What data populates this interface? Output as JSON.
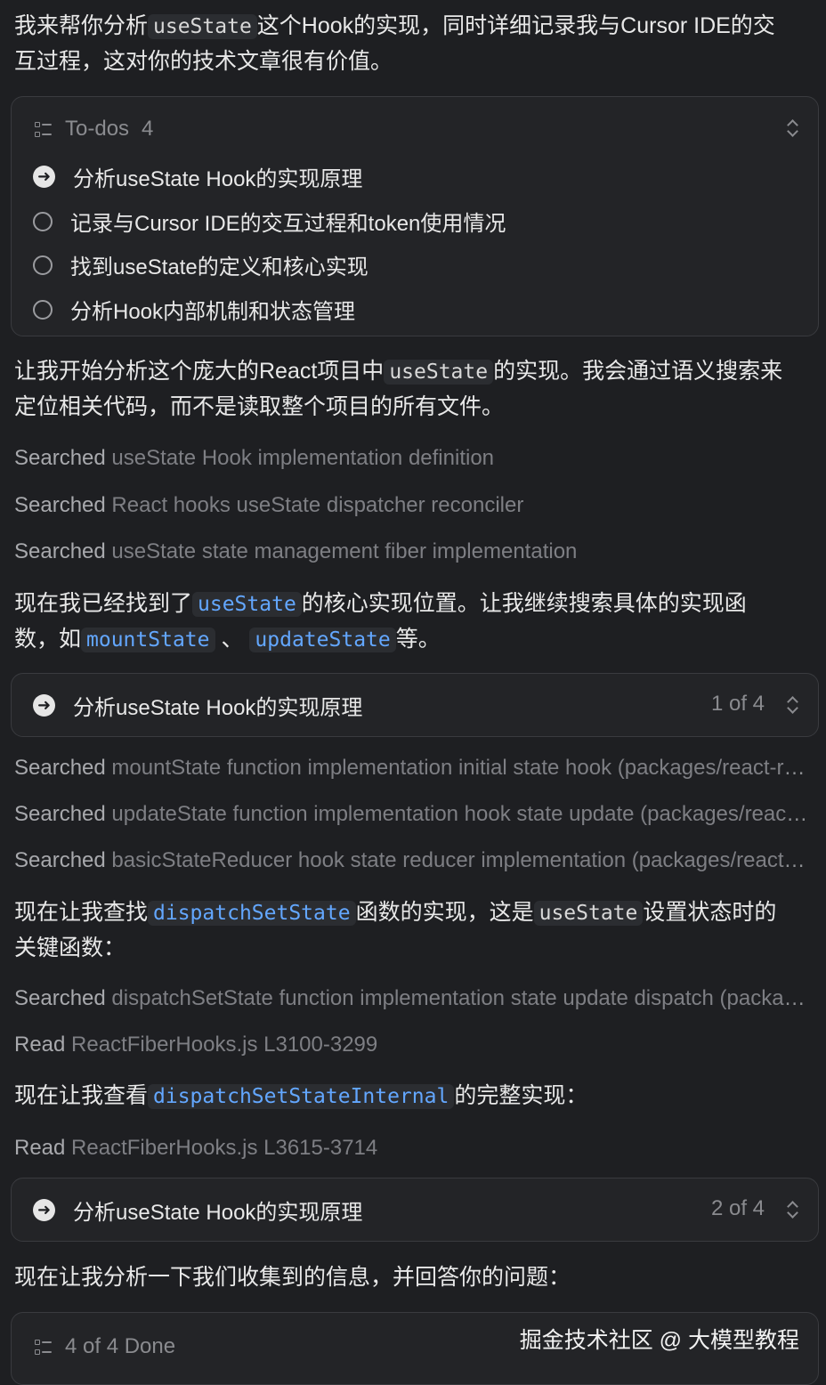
{
  "intro": {
    "p1": "我来帮你分析",
    "code": "useState",
    "p2": "这个Hook的实现，同时详细记录我与Cursor IDE的交",
    "p3": "互过程，这对你的技术文章很有价值。"
  },
  "todos": {
    "label": "To-dos",
    "count": "4",
    "items": [
      {
        "label": "分析useState Hook的实现原理",
        "status": "in-progress"
      },
      {
        "label": "记录与Cursor IDE的交互过程和token使用情况",
        "status": "pending"
      },
      {
        "label": "找到useState的定义和核心实现",
        "status": "pending"
      },
      {
        "label": "分析Hook内部机制和状态管理",
        "status": "pending"
      }
    ]
  },
  "para2": {
    "p1": "让我开始分析这个庞大的React项目中",
    "code": "useState",
    "p2": "的实现。我会通过语义搜索来",
    "p3": "定位相关代码，而不是读取整个项目的所有文件。"
  },
  "search_block_1": [
    {
      "verb": "Searched",
      "text": "useState Hook implementation definition"
    },
    {
      "verb": "Searched",
      "text": "React hooks useState dispatcher reconciler"
    },
    {
      "verb": "Searched",
      "text": "useState state management fiber implementation"
    }
  ],
  "para3": {
    "p1": "现在我已经找到了",
    "code1": "useState",
    "p2": "的核心实现位置。让我继续搜索具体的实现函",
    "p3": "数，如",
    "code2": "mountState",
    "p4": "、",
    "code3": "updateState",
    "p5": "等。"
  },
  "step1": {
    "title": "分析useState Hook的实现原理",
    "progress": "1 of 4"
  },
  "search_block_2": [
    {
      "verb": "Searched",
      "text": "mountState function implementation initial state hook (packages/react-reconciler)"
    },
    {
      "verb": "Searched",
      "text": "updateState function implementation hook state update (packages/react-reconciler)"
    },
    {
      "verb": "Searched",
      "text": "basicStateReducer hook state reducer implementation (packages/react-reconciler)"
    }
  ],
  "para4": {
    "p1": "现在让我查找",
    "code1": "dispatchSetState",
    "p2": "函数的实现，这是",
    "code2": "useState",
    "p3": "设置状态时的",
    "p4": "关键函数："
  },
  "search_block_3": [
    {
      "verb": "Searched",
      "text": "dispatchSetState function implementation state update dispatch (packages/react-reconciler)"
    },
    {
      "verb": "Read",
      "text": "ReactFiberHooks.js L3100-3299"
    }
  ],
  "para5": {
    "p1": "现在让我查看",
    "code": "dispatchSetStateInternal",
    "p2": "的完整实现："
  },
  "read_2": {
    "verb": "Read",
    "text": "ReactFiberHooks.js L3615-3714"
  },
  "step2": {
    "title": "分析useState Hook的实现原理",
    "progress": "2 of 4"
  },
  "para6": "现在让我分析一下我们收集到的信息，并回答你的问题：",
  "todos_done": {
    "label": "4 of 4 Done"
  },
  "watermark": "掘金技术社区 @ 大模型教程",
  "colors": {
    "background": "#1e1f22",
    "panel": "#232427",
    "link": "#63a7ff",
    "muted": "#8e8f93"
  }
}
